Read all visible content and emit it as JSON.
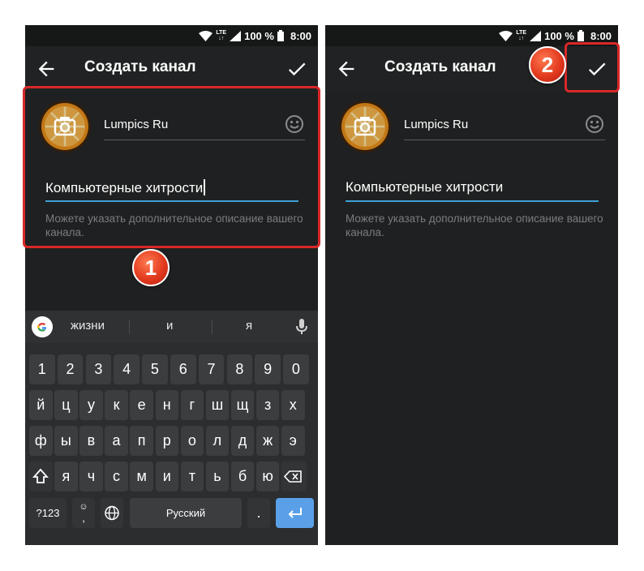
{
  "status": {
    "lte": "LTE",
    "battery": "100 %",
    "time": "8:00"
  },
  "appbar": {
    "title": "Создать канал"
  },
  "channel": {
    "name": "Lumpics Ru",
    "description": "Компьютерные хитрости",
    "hint": "Можете указать дополнительное описание вашего канала."
  },
  "badges": {
    "step1": "1",
    "step2": "2"
  },
  "keyboard": {
    "suggestions": [
      "жизни",
      "и",
      "я"
    ],
    "numbers": [
      "1",
      "2",
      "3",
      "4",
      "5",
      "6",
      "7",
      "8",
      "9",
      "0"
    ],
    "row1": [
      "й",
      "ц",
      "у",
      "к",
      "е",
      "н",
      "г",
      "ш",
      "щ",
      "з",
      "х"
    ],
    "row2": [
      "ф",
      "ы",
      "в",
      "а",
      "п",
      "р",
      "о",
      "л",
      "д",
      "ж",
      "э"
    ],
    "row3": [
      "я",
      "ч",
      "с",
      "м",
      "и",
      "т",
      "ь",
      "б",
      "ю"
    ],
    "symbols_label": "?123",
    "space_label": "Русский",
    "period": ".",
    "emoji_punct": ",",
    "colors": {
      "keyboard_bg": "#2b2d2f",
      "key_bg": "#3b3d3f",
      "enter": "#5aa0e8"
    }
  },
  "colors": {
    "background": "#1f2021",
    "accent": "#3ea0d8",
    "highlight": "#d92828",
    "badge": "#e23a1e"
  }
}
